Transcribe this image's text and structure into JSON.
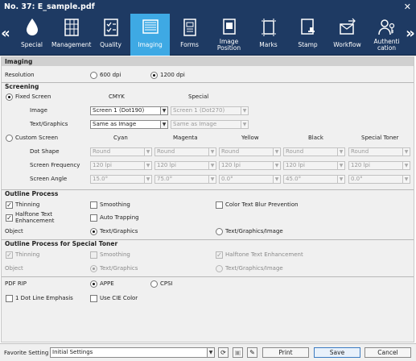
{
  "window": {
    "title": "No. 37: E_sample.pdf"
  },
  "toolbar": {
    "tabs": [
      {
        "label": "Special"
      },
      {
        "label": "Management"
      },
      {
        "label": "Quality"
      },
      {
        "label": "Imaging"
      },
      {
        "label": "Forms"
      },
      {
        "label": "Image\nPosition"
      },
      {
        "label": "Marks"
      },
      {
        "label": "Stamp"
      },
      {
        "label": "Workflow"
      },
      {
        "label": "Authenti\ncation"
      }
    ],
    "active_tab": "Imaging",
    "active_color": "#3ea9e4",
    "bar_color": "#1e3a63"
  },
  "imaging": {
    "header": "Imaging",
    "resolution": {
      "label": "Resolution",
      "options": [
        "600 dpi",
        "1200 dpi"
      ],
      "selected": "1200 dpi"
    },
    "screening": {
      "header": "Screening",
      "fixed_screen": {
        "label": "Fixed Screen",
        "selected": true,
        "col_cmyk": "CMYK",
        "col_special": "Special",
        "image_label": "Image",
        "image_cmyk": "Screen 1 (Dot190)",
        "image_special": "Screen 1 (Dot270)",
        "text_label": "Text/Graphics",
        "text_cmyk": "Same as Image",
        "text_special": "Same as Image"
      },
      "custom_screen": {
        "label": "Custom Screen",
        "selected": false,
        "columns": [
          "Cyan",
          "Magenta",
          "Yellow",
          "Black",
          "Special Toner"
        ],
        "rows": [
          {
            "label": "Dot Shape",
            "values": [
              "Round",
              "Round",
              "Round",
              "Round",
              "Round"
            ]
          },
          {
            "label": "Screen Frequency",
            "values": [
              "120 lpi",
              "120 lpi",
              "120 lpi",
              "120 lpi",
              "120 lpi"
            ]
          },
          {
            "label": "Screen Angle",
            "values": [
              "15.0°",
              "75.0°",
              "0.0°",
              "45.0°",
              "0.0°"
            ]
          }
        ]
      }
    },
    "outline": {
      "header": "Outline Process",
      "thinning": {
        "label": "Thinning",
        "checked": true
      },
      "smoothing": {
        "label": "Smoothing",
        "checked": false
      },
      "color_text_blur": {
        "label": "Color Text Blur Prevention",
        "checked": false
      },
      "halftone": {
        "label": "Halftone Text\nEnhancement",
        "checked": true
      },
      "auto_trapping": {
        "label": "Auto Trapping",
        "checked": false
      },
      "object_label": "Object",
      "object_options": [
        "Text/Graphics",
        "Text/Graphics/Image"
      ],
      "object_selected": "Text/Graphics"
    },
    "outline_special": {
      "header": "Outline Process for Special Toner",
      "thinning": {
        "label": "Thinning",
        "checked": true
      },
      "smoothing": {
        "label": "Smoothing",
        "checked": false
      },
      "halftone": {
        "label": "Halftone Text Enhancement",
        "checked": true
      },
      "object_label": "Object",
      "object_options": [
        "Text/Graphics",
        "Text/Graphics/Image"
      ],
      "object_selected": "Text/Graphics"
    },
    "pdf_rip": {
      "label": "PDF RIP",
      "options": [
        "APPE",
        "CPSI"
      ],
      "selected": "APPE"
    },
    "dot_line": {
      "label": "1 Dot Line Emphasis",
      "checked": false
    },
    "cie_color": {
      "label": "Use CIE Color",
      "checked": false
    }
  },
  "footer": {
    "favorite_label": "Favorite Setting",
    "favorite_value": "Initial Settings",
    "print": "Print",
    "save": "Save",
    "cancel": "Cancel"
  }
}
